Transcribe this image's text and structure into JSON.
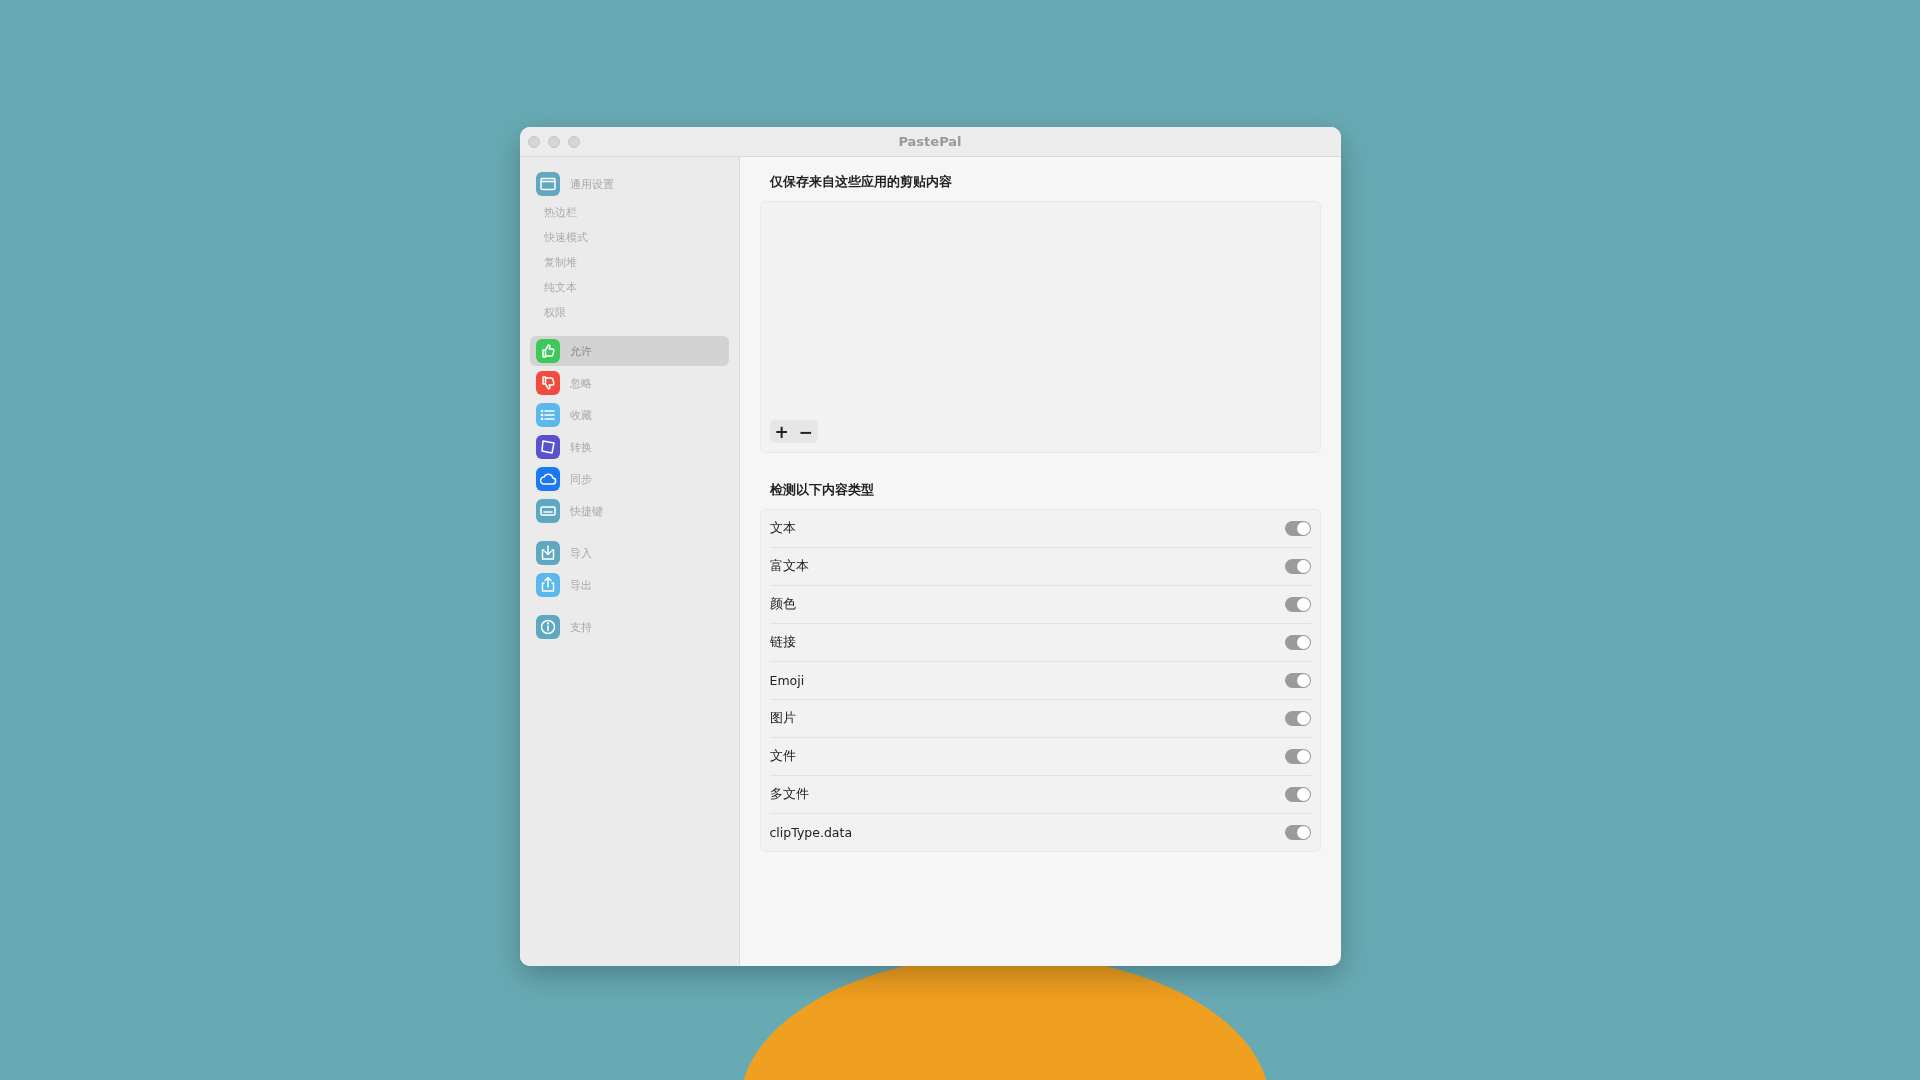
{
  "window": {
    "title": "PastePal"
  },
  "sidebar": {
    "sections": [
      [
        {
          "label": "通用设置",
          "color": "#5fa8c0",
          "selected": false,
          "children": [
            {
              "label": "热边栏",
              "selected": false
            },
            {
              "label": "快速模式",
              "selected": false
            },
            {
              "label": "复制堆",
              "selected": false
            },
            {
              "label": "纯文本",
              "selected": false
            },
            {
              "label": "权限",
              "selected": false
            }
          ]
        }
      ],
      [
        {
          "label": "允许",
          "color": "#3cc95a",
          "selected": true
        },
        {
          "label": "忽略",
          "color": "#f04b3e",
          "selected": false
        },
        {
          "label": "收藏",
          "color": "#5ab8ec",
          "selected": false
        },
        {
          "label": "转换",
          "color": "#5a52cc",
          "selected": false
        },
        {
          "label": "同步",
          "color": "#1a78f0",
          "selected": false
        },
        {
          "label": "快捷键",
          "color": "#5fa8c0",
          "selected": false
        }
      ],
      [
        {
          "label": "导入",
          "color": "#5fa8c0",
          "selected": false
        },
        {
          "label": "导出",
          "color": "#5ab8ec",
          "selected": false
        }
      ],
      [
        {
          "label": "支持",
          "color": "#5fa8c0",
          "selected": false
        }
      ]
    ]
  },
  "apps_section": {
    "title": "仅保存来自这些应用的剪贴内容",
    "buttons": [
      "+",
      "−"
    ]
  },
  "types_section": {
    "title": "检测以下内容类型",
    "rows": [
      {
        "label": "文本",
        "on": true
      },
      {
        "label": "富文本",
        "on": true
      },
      {
        "label": "颜色",
        "on": true
      },
      {
        "label": "链接",
        "on": true
      },
      {
        "label": "Emoji",
        "on": true
      },
      {
        "label": "图片",
        "on": true
      },
      {
        "label": "文件",
        "on": true
      },
      {
        "label": "多文件",
        "on": true
      },
      {
        "label": "clipType.data",
        "on": true
      }
    ]
  }
}
